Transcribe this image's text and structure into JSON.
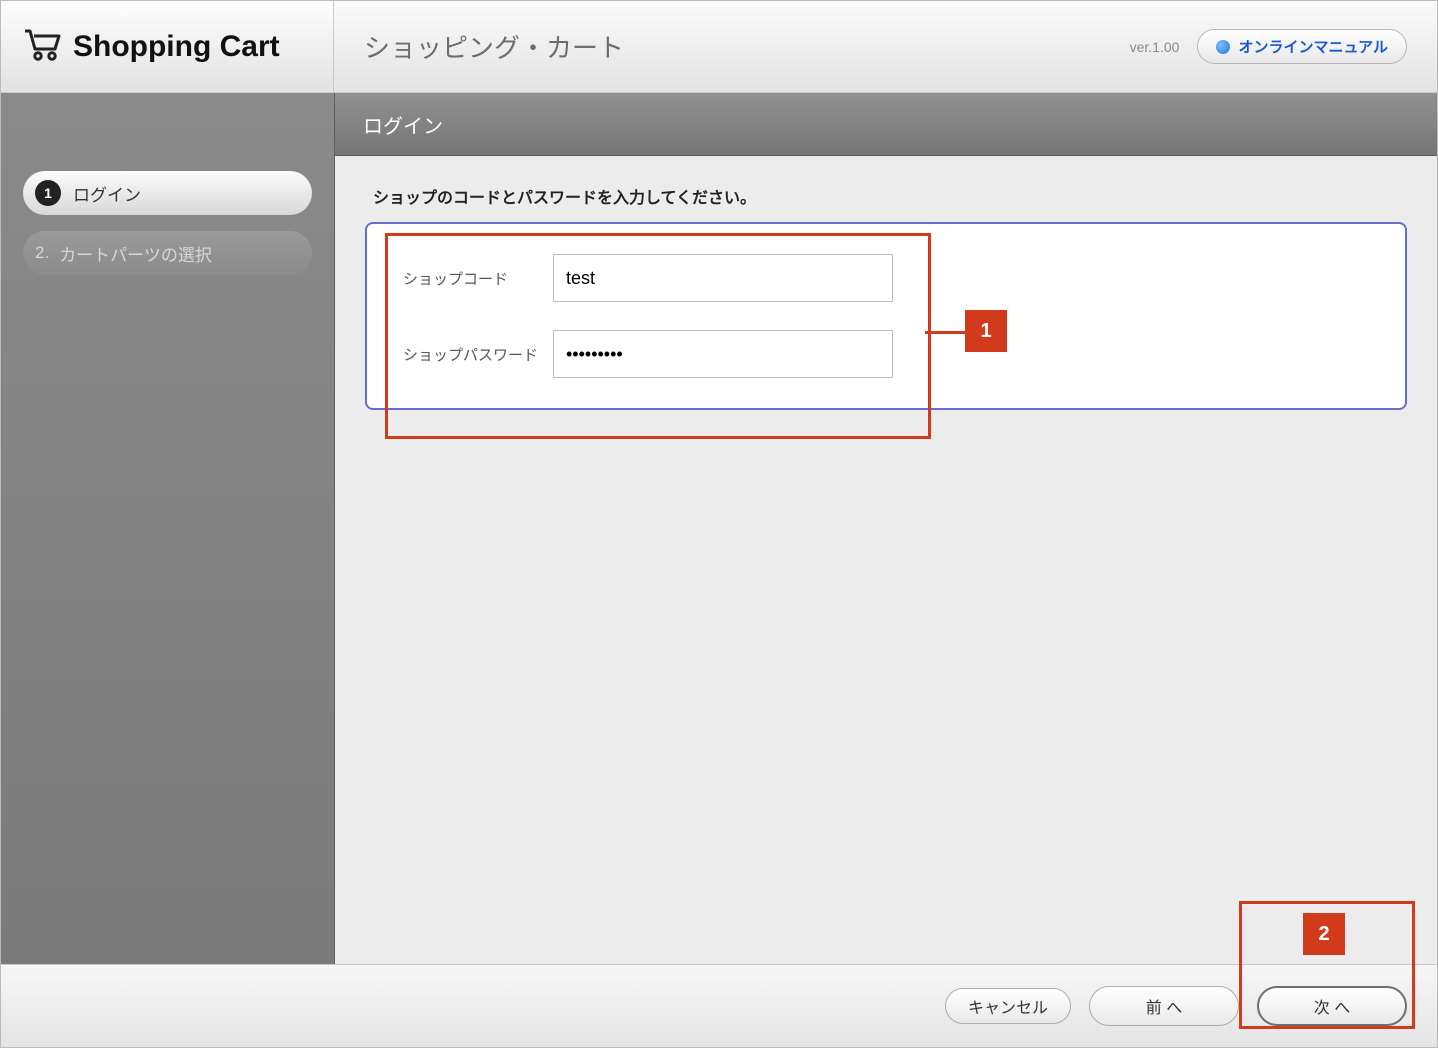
{
  "header": {
    "app_title": "Shopping Cart",
    "page_title": "ショッピング・カート",
    "version": "ver.1.00",
    "manual_label": "オンラインマニュアル"
  },
  "sidebar": {
    "steps": [
      {
        "num": "1",
        "label": "ログイン",
        "active": true
      },
      {
        "num": "2.",
        "label": "カートパーツの選択",
        "active": false
      }
    ]
  },
  "main": {
    "section_title": "ログイン",
    "instruction": "ショップのコードとパスワードを入力してください。",
    "fields": {
      "shop_code_label": "ショップコード",
      "shop_code_value": "test",
      "shop_password_label": "ショップパスワード",
      "shop_password_value": "•••••••••"
    }
  },
  "callouts": {
    "c1": "1",
    "c2": "2"
  },
  "footer": {
    "cancel": "キャンセル",
    "prev": "前 へ",
    "next": "次 へ"
  }
}
